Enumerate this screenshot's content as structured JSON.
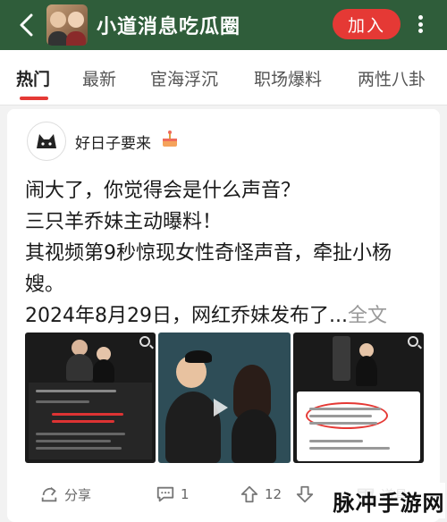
{
  "header": {
    "group_name": "小道消息吃瓜圈",
    "join_label": "加入"
  },
  "tabs": [
    {
      "label": "热门",
      "active": true
    },
    {
      "label": "最新",
      "active": false
    },
    {
      "label": "宦海浮沉",
      "active": false
    },
    {
      "label": "职场爆料",
      "active": false
    },
    {
      "label": "两性八卦",
      "active": false
    }
  ],
  "post": {
    "author": "好日子要来",
    "lines": [
      "闹大了，你觉得会是什么声音？",
      "三只羊乔妹主动曝料！",
      "其视频第9秒惊现女性奇怪声音，牵扯小杨",
      "嫂。",
      "2024年8月29日，网红乔妹发布了..."
    ],
    "more_label": "全文"
  },
  "actions": {
    "share_label": "分享",
    "comment_count": "1",
    "vote_count": "12",
    "tools_label": "道具"
  },
  "watermark": "脉冲手游网",
  "icons": [
    "back-arrow-icon",
    "more-dots-icon",
    "share-icon",
    "comment-icon",
    "upvote-icon",
    "downvote-icon",
    "tools-icon"
  ],
  "colors": {
    "header_bg": "#2f5d3a",
    "accent": "#e53935"
  }
}
